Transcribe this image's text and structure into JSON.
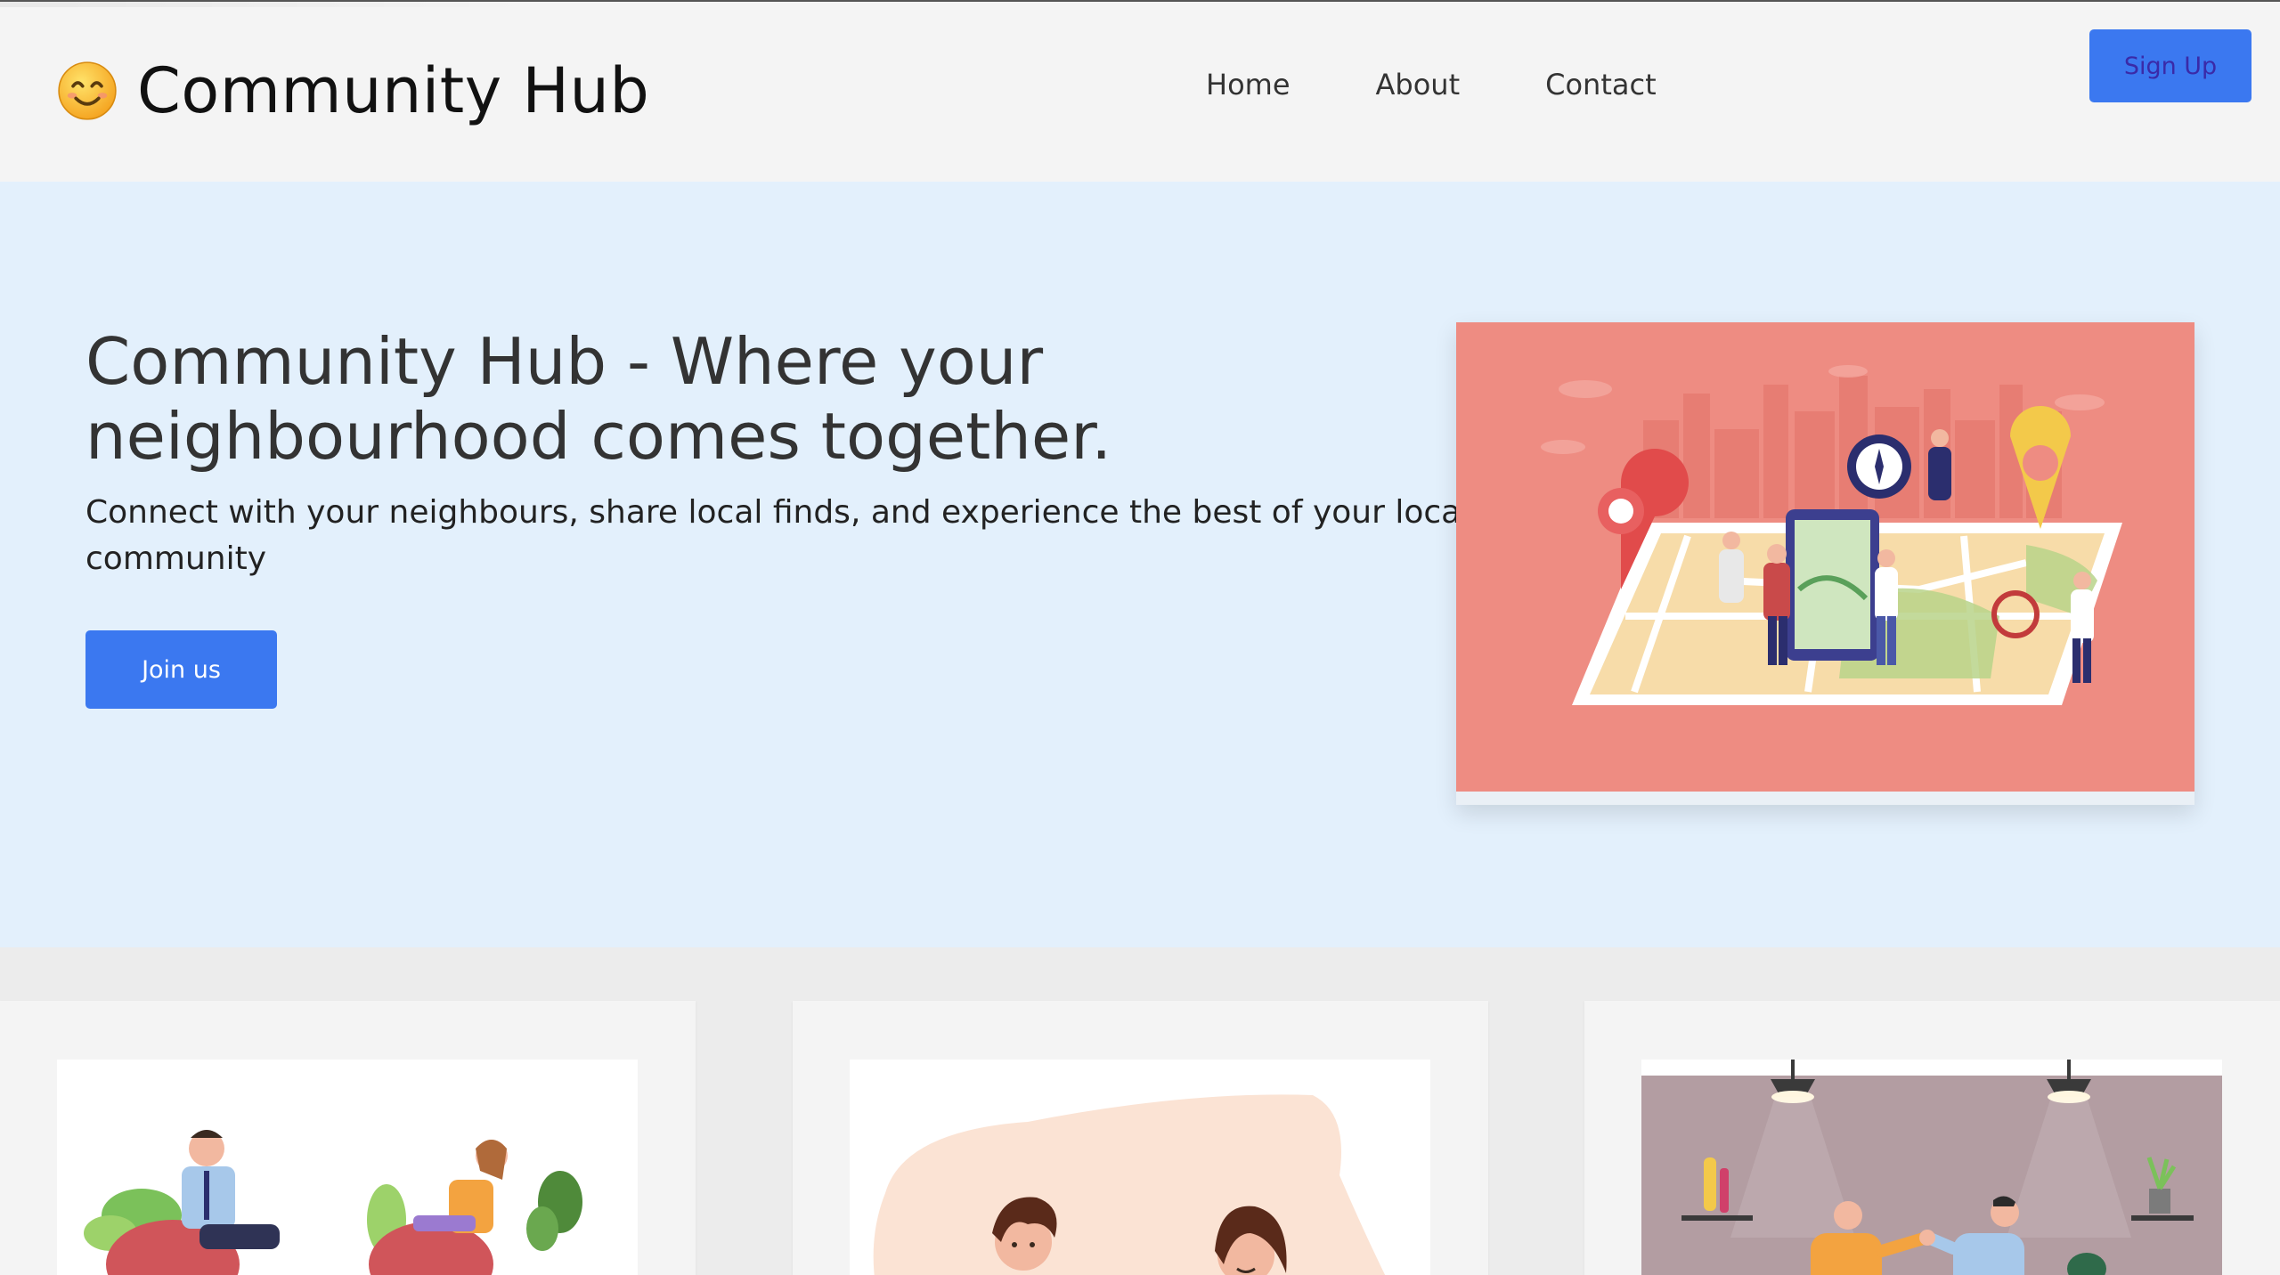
{
  "header": {
    "logo_icon": "smiling-face-emoji",
    "brand": "Community Hub",
    "nav": [
      {
        "label": "Home"
      },
      {
        "label": "About"
      },
      {
        "label": "Contact"
      }
    ],
    "signup_label": "Sign Up"
  },
  "hero": {
    "title": "Community Hub - Where your neighbourhood comes together.",
    "subtitle": "Connect with your neighbours, share local finds, and experience the best of your local community",
    "cta_label": "Join us",
    "image": "city-map-illustration"
  },
  "cards": [
    {
      "image": "people-relaxing-illustration"
    },
    {
      "image": "people-chatting-illustration"
    },
    {
      "image": "handshake-meeting-illustration"
    }
  ],
  "colors": {
    "header_bg": "#f4f4f4",
    "hero_bg": "#e3f0fc",
    "primary": "#3b78f0",
    "hero_image_bg": "#ee8c82",
    "page_bg": "#ececec"
  }
}
